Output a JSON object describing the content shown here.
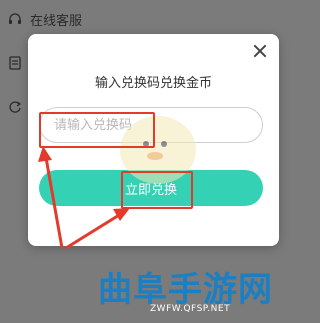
{
  "menu": {
    "items": [
      {
        "label": "在线客服",
        "icon": "headset-icon"
      },
      {
        "label": "",
        "icon": "document-icon"
      },
      {
        "label": "",
        "icon": "refresh-icon"
      }
    ]
  },
  "dialog": {
    "title": "输入兑换码兑换金币",
    "input_placeholder": "请输入兑换码",
    "input_value": "",
    "submit_label": "立即兑换",
    "close_icon": "close-icon"
  },
  "colors": {
    "accent": "#35d1b4",
    "highlight": "#e23b2c",
    "overlay": "#7b7b7b"
  },
  "watermark": {
    "text": "曲阜手游网",
    "url": "ZWFW.QFSP.NET"
  }
}
